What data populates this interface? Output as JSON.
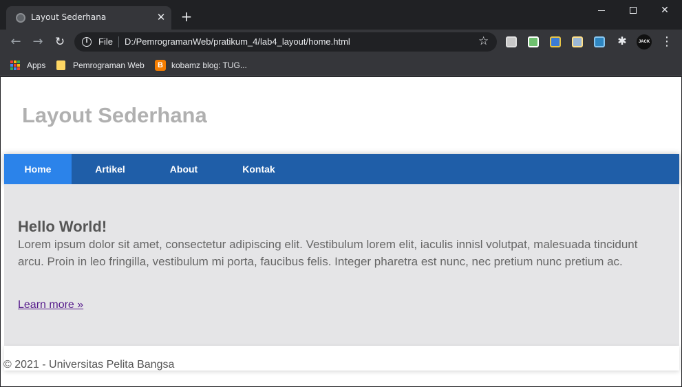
{
  "browser": {
    "tab": {
      "title": "Layout Sederhana",
      "close_glyph": "✕"
    },
    "new_tab_glyph": "+",
    "window_controls": {
      "close_glyph": "✕"
    },
    "toolbar": {
      "back_glyph": "←",
      "forward_glyph": "→",
      "reload_glyph": "↻",
      "info_glyph": "i",
      "scheme_label": "File",
      "url": "D:/PemrogramanWeb/pratikum_4/lab4_layout/home.html",
      "star_glyph": "☆",
      "puzzle_glyph": "✱",
      "avatar_text": "JACK JACK",
      "menu_glyph": "⋮"
    },
    "bookmarks": [
      {
        "label": "Apps",
        "icon": "apps-grid-icon"
      },
      {
        "label": "Pemrograman Web",
        "icon": "folder-icon"
      },
      {
        "label": "kobamz blog: TUG...",
        "icon": "blogger-icon"
      }
    ],
    "blogger_glyph": "B"
  },
  "page": {
    "title": "Layout Sederhana",
    "nav": [
      {
        "label": "Home",
        "active": true
      },
      {
        "label": "Artikel",
        "active": false
      },
      {
        "label": "About",
        "active": false
      },
      {
        "label": "Kontak",
        "active": false
      }
    ],
    "hero": {
      "heading": "Hello World!",
      "body": "Lorem ipsum dolor sit amet, consectetur adipiscing elit. Vestibulum lorem elit, iaculis innisl volutpat, malesuada tincidunt arcu. Proin in leo fringilla, vestibulum mi porta, faucibus felis. Integer pharetra est nunc, nec pretium nunc pretium ac.",
      "link": "Learn more »"
    },
    "footer": "© 2021 - Universitas Pelita Bangsa"
  },
  "colors": {
    "nav_bg": "#1f5ea8",
    "nav_active": "#2b83ea",
    "hero_bg": "#e5e5e7",
    "title_color": "#b0b0b0",
    "link_visited": "#551a8b"
  }
}
